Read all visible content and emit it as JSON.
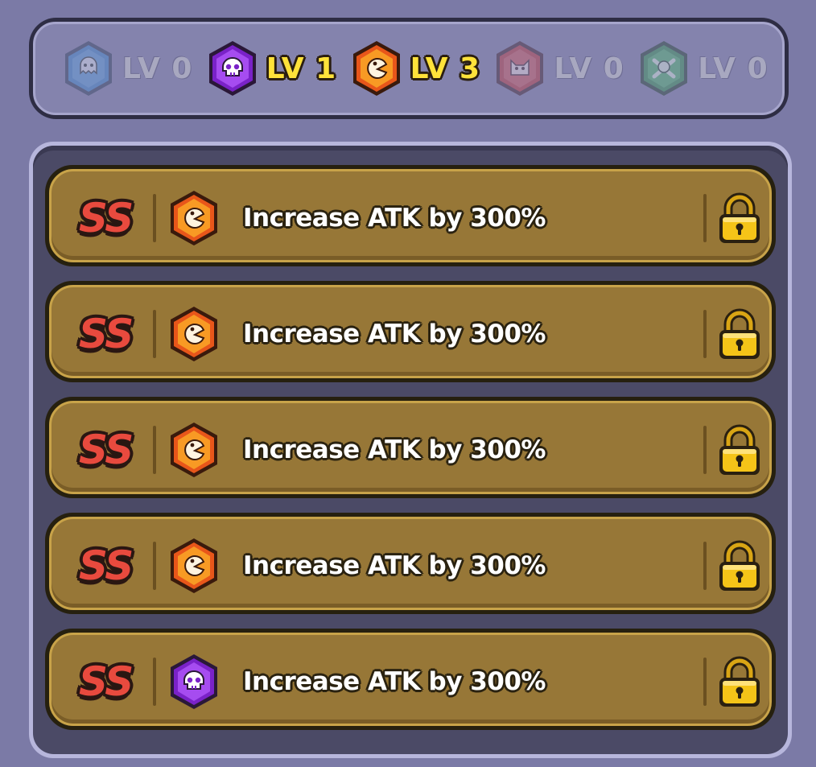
{
  "level_bar": {
    "items": [
      {
        "icon": "ghost-icon",
        "color": "#2f7fc8",
        "label": "LV 0",
        "state": "inactive"
      },
      {
        "icon": "skull-icon",
        "color": "#8d2ee0",
        "label": "LV 1",
        "state": "active"
      },
      {
        "icon": "chomp-icon",
        "color": "#f0701a",
        "label": "LV 3",
        "state": "active"
      },
      {
        "icon": "cat-icon",
        "color": "#c23a3a",
        "label": "LV 0",
        "state": "inactive"
      },
      {
        "icon": "crossbones-icon",
        "color": "#2f9a4a",
        "label": "LV 0",
        "state": "inactive"
      }
    ]
  },
  "options": [
    {
      "grade": "SS",
      "icon": "chomp-icon",
      "description": "Increase ATK by 300%",
      "locked": true
    },
    {
      "grade": "SS",
      "icon": "chomp-icon",
      "description": "Increase ATK by 300%",
      "locked": true
    },
    {
      "grade": "SS",
      "icon": "chomp-icon",
      "description": "Increase ATK by 300%",
      "locked": true
    },
    {
      "grade": "SS",
      "icon": "chomp-icon",
      "description": "Increase ATK by 300%",
      "locked": true
    },
    {
      "grade": "SS",
      "icon": "skull-icon",
      "description": "Increase ATK by 300%",
      "locked": true
    }
  ],
  "colors": {
    "background": "#7b7aa6",
    "row_gold": "#977737",
    "grade_red": "#e84a3e",
    "level_yellow": "#ffe23a",
    "lock_yellow": "#f5c418"
  }
}
